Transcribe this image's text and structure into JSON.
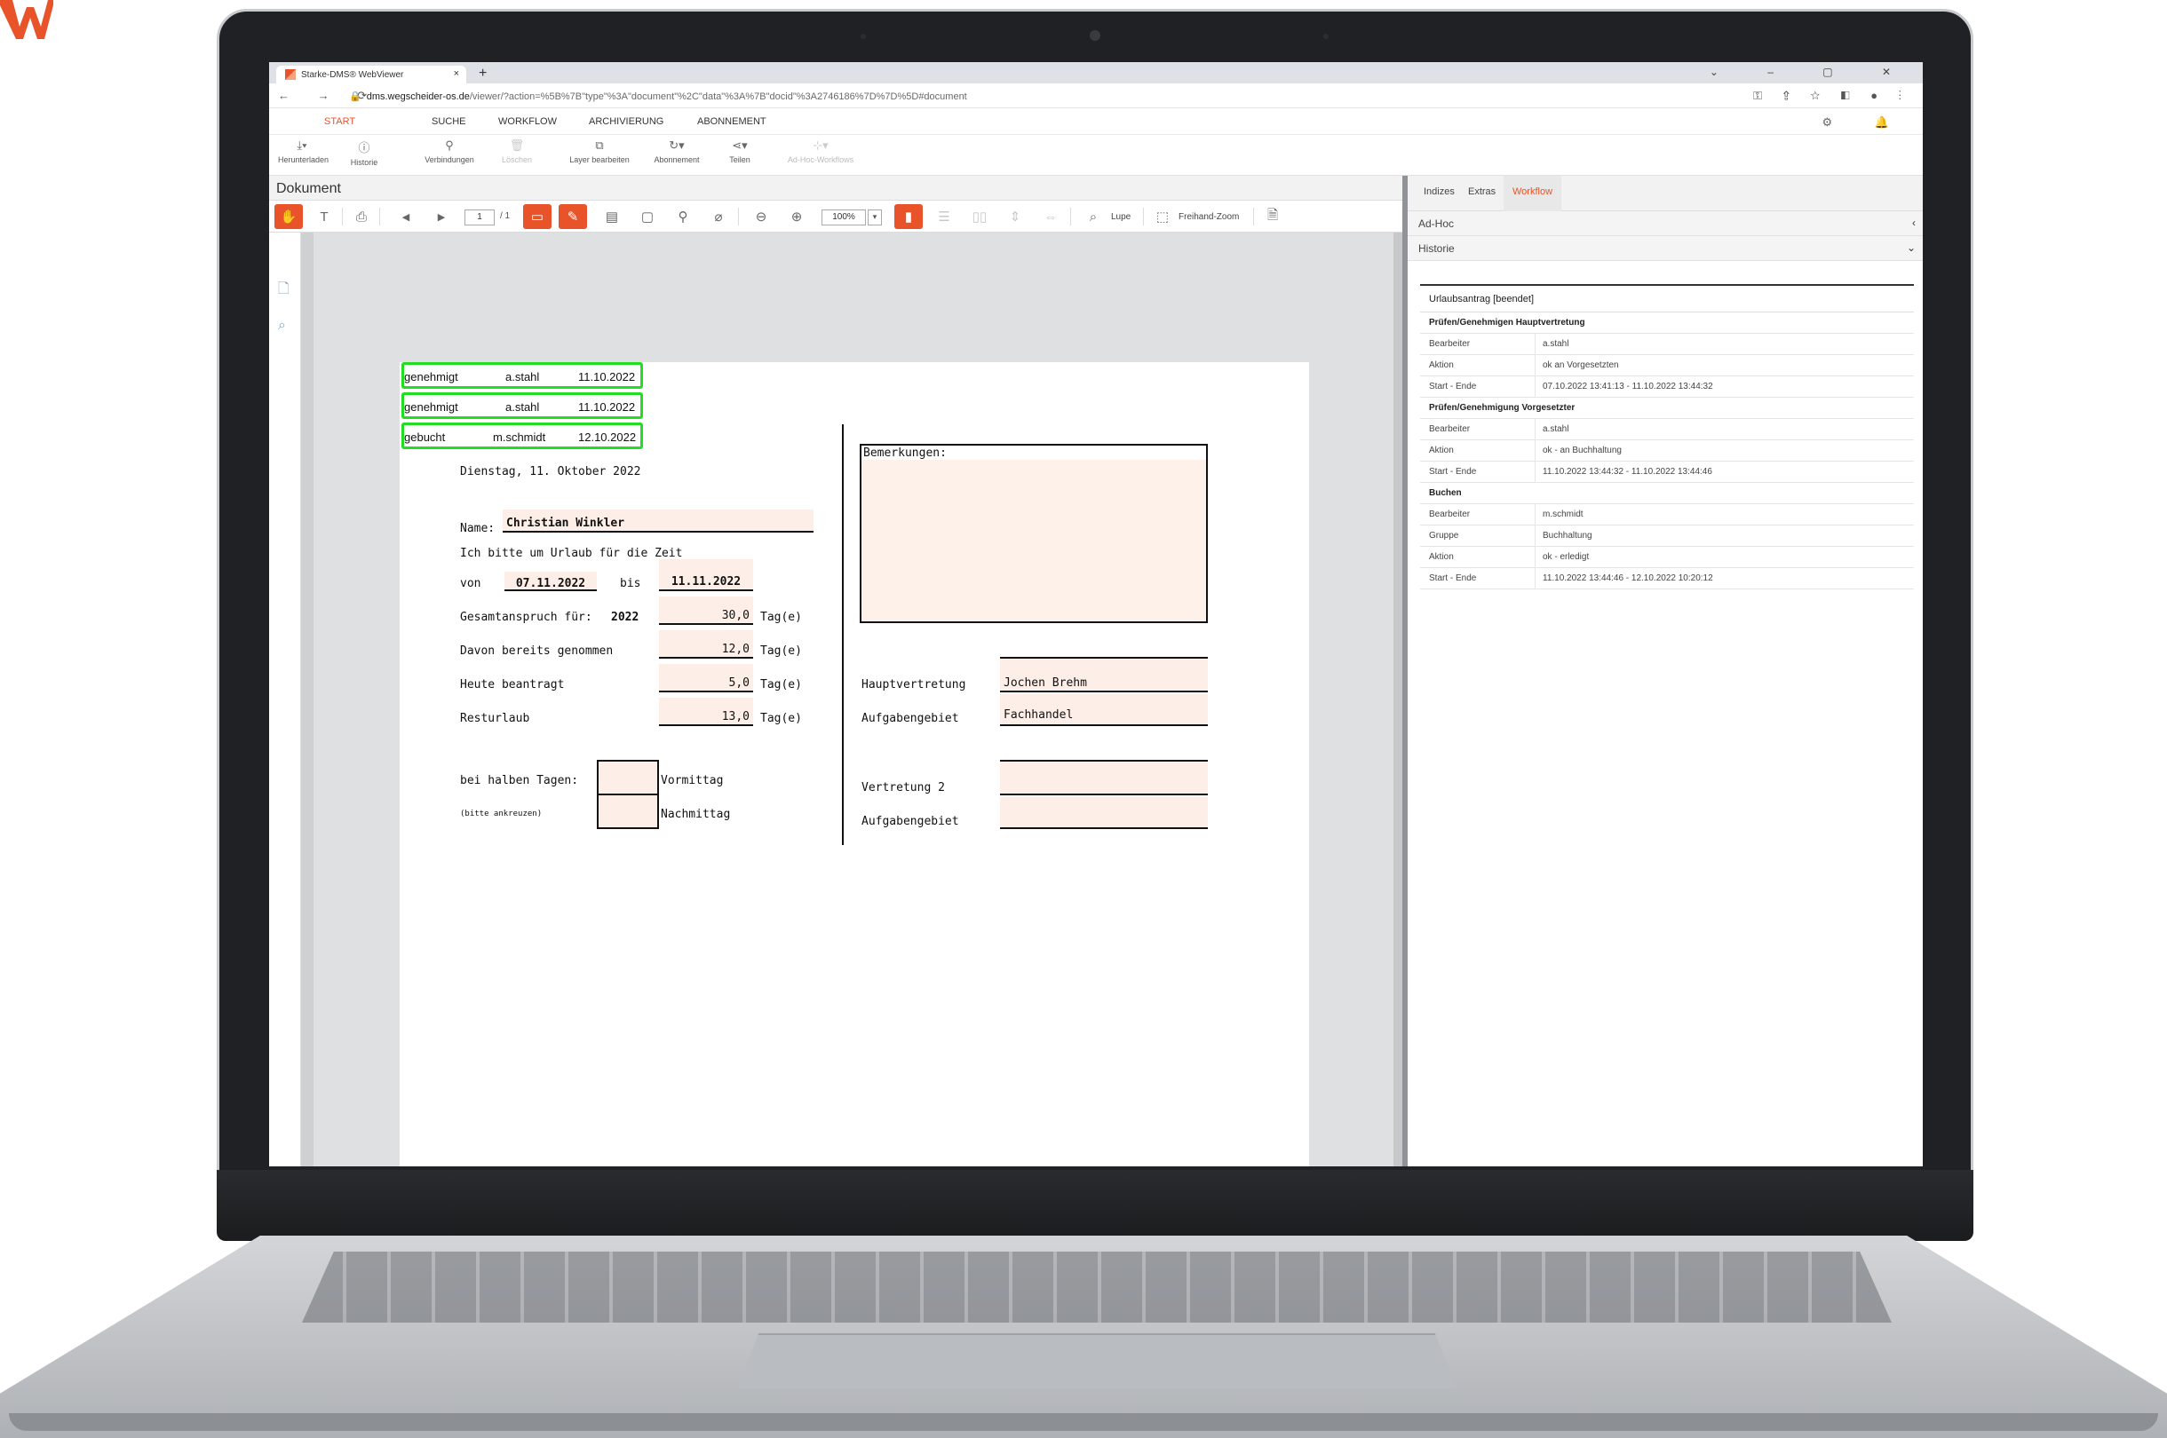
{
  "browser": {
    "tab_title": "Starke-DMS® WebViewer",
    "tab_close": "×",
    "new_tab": "+",
    "url_host": "dms.wegscheider-os.de",
    "url_path": "/viewer/?action=%5B%7B\"type\"%3A\"document\"%2C\"data\"%3A%7B\"docid\"%3A2746186%7D%7D%5D#document"
  },
  "menu": {
    "items": [
      "START",
      "SUCHE",
      "WORKFLOW",
      "ARCHIVIERUNG",
      "ABONNEMENT"
    ],
    "active": "START"
  },
  "ribbon": {
    "buttons": [
      {
        "label": "Herunterladen",
        "icon": "download-icon",
        "enabled": true
      },
      {
        "label": "Historie",
        "icon": "info-icon",
        "enabled": true
      },
      {
        "label": "Verbindungen",
        "icon": "link-icon",
        "enabled": true
      },
      {
        "label": "Löschen",
        "icon": "trash-icon",
        "enabled": false
      },
      {
        "label": "Layer bearbeiten",
        "icon": "layer-icon",
        "enabled": true
      },
      {
        "label": "Abonnement",
        "icon": "subscribe-icon",
        "enabled": true
      },
      {
        "label": "Teilen",
        "icon": "share-icon",
        "enabled": true
      },
      {
        "label": "Ad-Hoc-Workflows",
        "icon": "workflow-icon",
        "enabled": false
      }
    ]
  },
  "document_pane": {
    "header": "Dokument",
    "page_current": "1",
    "page_total": "/ 1",
    "zoom": "100%",
    "lupe_label": "Lupe",
    "freihand_label": "Freihand-Zoom"
  },
  "form": {
    "stamps": [
      {
        "status": "genehmigt",
        "user": "a.stahl",
        "date": "11.10.2022"
      },
      {
        "status": "genehmigt",
        "user": "a.stahl",
        "date": "11.10.2022"
      },
      {
        "status": "gebucht",
        "user": "m.schmidt",
        "date": "12.10.2022"
      }
    ],
    "date_line": "Dienstag, 11. Oktober 2022",
    "name_label": "Name:",
    "name_value": "Christian Winkler",
    "request_text": "Ich bitte um Urlaub für die Zeit",
    "von_label": "von",
    "von_value": "07.11.2022",
    "bis_label": "bis",
    "bis_value": "11.11.2022",
    "gesamt_label": "Gesamtanspruch für:",
    "gesamt_year": "2022",
    "gesamt_value": "30,0",
    "davon_label": "Davon bereits genommen",
    "davon_value": "12,0",
    "heute_label": "Heute beantragt",
    "heute_value": "5,0",
    "rest_label": "Resturlaub",
    "rest_value": "13,0",
    "unit": "Tag(e)",
    "halb_label": "bei halben Tagen:",
    "halb_hint": "(bitte ankreuzen)",
    "vormittag": "Vormittag",
    "nachmittag": "Nachmittag",
    "bemerkungen_label": "Bemerkungen:",
    "hauptvertretung_label": "Hauptvertretung",
    "hauptvertretung_value": "Jochen Brehm",
    "aufgabengebiet_label": "Aufgabengebiet",
    "aufgabengebiet_value": "Fachhandel",
    "vertretung2_label": "Vertretung 2",
    "aufgabengebiet2_label": "Aufgabengebiet"
  },
  "right_panel": {
    "tabs": [
      "Indizes",
      "Extras",
      "Workflow"
    ],
    "active_tab": "Workflow",
    "adhoc_label": "Ad-Hoc",
    "historie_label": "Historie",
    "workflow_title": "Urlaubsantrag [beendet]",
    "groups": [
      {
        "title": "Prüfen/Genehmigen Hauptvertretung",
        "rows": [
          {
            "key": "Bearbeiter",
            "value": "a.stahl"
          },
          {
            "key": "Aktion",
            "value": "ok an Vorgesetzten"
          },
          {
            "key": "Start - Ende",
            "value": "07.10.2022 13:41:13 - 11.10.2022 13:44:32"
          }
        ]
      },
      {
        "title": "Prüfen/Genehmigung Vorgesetzter",
        "rows": [
          {
            "key": "Bearbeiter",
            "value": "a.stahl"
          },
          {
            "key": "Aktion",
            "value": "ok - an Buchhaltung"
          },
          {
            "key": "Start - Ende",
            "value": "11.10.2022 13:44:32 - 11.10.2022 13:44:46"
          }
        ]
      },
      {
        "title": "Buchen",
        "rows": [
          {
            "key": "Bearbeiter",
            "value": "m.schmidt"
          },
          {
            "key": "Gruppe",
            "value": "Buchhaltung"
          },
          {
            "key": "Aktion",
            "value": "ok - erledigt"
          },
          {
            "key": "Start - Ende",
            "value": "11.10.2022 13:44:46 - 12.10.2022 10:20:12"
          }
        ]
      }
    ]
  },
  "colors": {
    "accent": "#e8532a",
    "stamp_border": "#22dd22",
    "field_fill": "#fdeee7"
  }
}
